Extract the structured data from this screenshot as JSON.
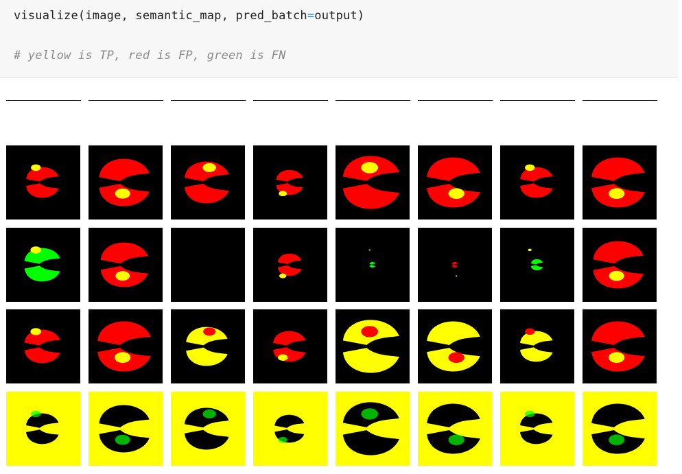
{
  "code_cell": {
    "fn": "visualize",
    "args": "image, semantic_map, pred_batch",
    "op": "=",
    "arg_value": "output",
    "comment": "# yellow is TP, red is FP, green is FN"
  },
  "legend_colors": {
    "tp": "#ffff00",
    "fp": "#ff0000",
    "fn": "#00ff00",
    "tn": "#000000"
  },
  "grid": {
    "columns": 8,
    "rows": [
      {
        "name": "prediction-row-1",
        "background": "black"
      },
      {
        "name": "prediction-row-2",
        "background": "black"
      },
      {
        "name": "prediction-row-3",
        "background": "black"
      },
      {
        "name": "prediction-row-4",
        "background": "yellow"
      }
    ]
  }
}
